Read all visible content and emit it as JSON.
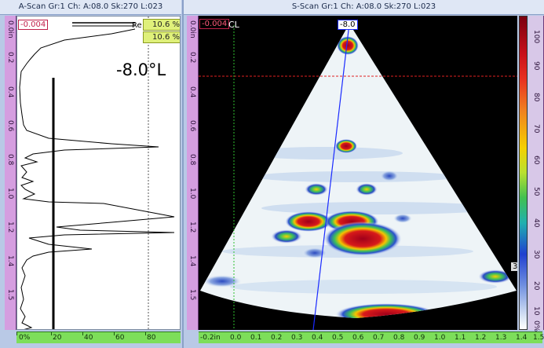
{
  "ascan": {
    "title": "A-Scan Gr:1 Ch: A:08.0 Sk:270 L:023",
    "cursor_value": "-0.004",
    "angle_label": "-8.0°L",
    "gate_tag": "Re",
    "gate_value_1": "10.6 %",
    "gate_value_2": "10.6 %",
    "depth_ticks": [
      "0.0in",
      "0.2",
      "0.4",
      "0.6",
      "0.8",
      "1.0",
      "1.2",
      "1.4",
      "1.5"
    ],
    "amp_ticks": [
      "0%",
      "20",
      "40",
      "60",
      "80"
    ]
  },
  "sscan": {
    "title": "S-Scan Gr:1 Ch: A:08.0 Sk:270 L:023",
    "cursor_value": "-0.004",
    "cl_label": "CL",
    "angle_marker": "-8.0",
    "right_marker": "3",
    "depth_ticks": [
      "0.0in",
      "0.2",
      "0.4",
      "0.6",
      "0.8",
      "1.0",
      "1.2",
      "1.4",
      "1.5"
    ],
    "index_ticks": [
      "-0.2in",
      "0.0",
      "0.1",
      "0.2",
      "0.3",
      "0.4",
      "0.5",
      "0.6",
      "0.7",
      "0.8",
      "0.9",
      "1.0",
      "1.1",
      "1.2",
      "1.3",
      "1.4",
      "1.5"
    ],
    "colorbar_ticks": [
      "100",
      "90",
      "80",
      "70",
      "60",
      "50",
      "40",
      "30",
      "20",
      "10",
      "0%"
    ]
  }
}
